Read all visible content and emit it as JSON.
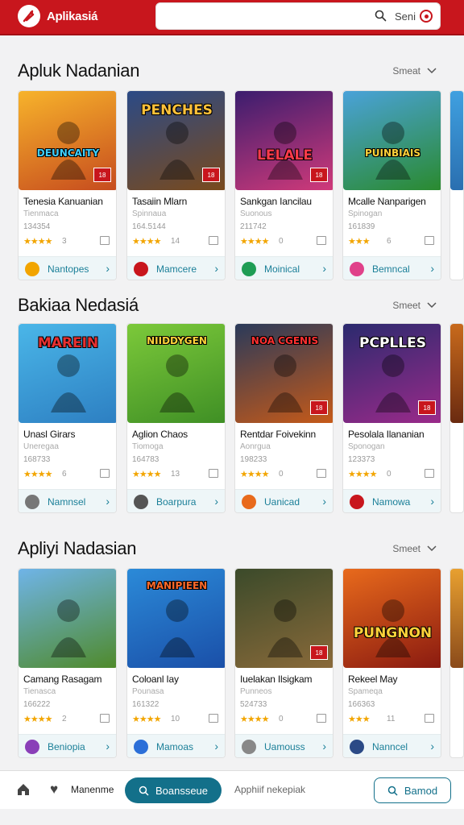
{
  "header": {
    "app_name": "Aplikasiá",
    "search_text": "Seni"
  },
  "sections": [
    {
      "title": "Apluk Nadanian",
      "more": "Smeat",
      "cards": [
        {
          "art_text": "DEUNCAITY",
          "art_colors": [
            "#f7b32b",
            "#c64b1e"
          ],
          "text_color": "#3fd0ff",
          "name": "Tenesia Kanuanian",
          "sub": "Tienmaca",
          "size": "134354",
          "stars": "★★★★",
          "rating_count": "3",
          "foot_label": "Nantopes",
          "foot_icon_color": "#f2a500"
        },
        {
          "art_text": "PENCHES",
          "art_colors": [
            "#2b4a86",
            "#7a4a1c"
          ],
          "text_color": "#ffc23a",
          "name": "Tasaiin Mlarn",
          "sub": "Spinnaua",
          "size": "164.5144",
          "stars": "★★★★",
          "rating_count": "14",
          "foot_label": "Mamcere",
          "foot_icon_color": "#c8161d"
        },
        {
          "art_text": "LELALE",
          "art_colors": [
            "#3b1d6e",
            "#d13a7a"
          ],
          "text_color": "#ff3b4a",
          "name": "Sankgan Iancilau",
          "sub": "Suonous",
          "size": "211742",
          "stars": "★★★★",
          "rating_count": "0",
          "foot_label": "Moinical",
          "foot_icon_color": "#1f9d55"
        },
        {
          "art_text": "PUINBIAIS",
          "art_colors": [
            "#4aa2d9",
            "#2a8a2e"
          ],
          "text_color": "#ffd23a",
          "name": "Mcalle Nanparigen",
          "sub": "Spinogan",
          "size": "161839",
          "stars": "★★★",
          "rating_count": "6",
          "foot_label": "Bemncal",
          "foot_icon_color": "#e0418a"
        }
      ]
    },
    {
      "title": "Bakiaa Nedasiá",
      "more": "Smeet",
      "cards": [
        {
          "art_text": "MAREIN",
          "art_colors": [
            "#4ab6e8",
            "#2d7fc2"
          ],
          "text_color": "#e83030",
          "name": "Unasl Girars",
          "sub": "Uneregaa",
          "size": "168733",
          "stars": "★★★★",
          "rating_count": "6",
          "foot_label": "Namnsel",
          "foot_icon_color": "#777"
        },
        {
          "art_text": "NIIDDYGEN",
          "art_colors": [
            "#7cc93a",
            "#3f8f25"
          ],
          "text_color": "#ffd23a",
          "name": "Aglion Chaos",
          "sub": "Tiomoga",
          "size": "164783",
          "stars": "★★★★",
          "rating_count": "13",
          "foot_label": "Boarpura",
          "foot_icon_color": "#555"
        },
        {
          "art_text": "NOA CGENIS",
          "art_colors": [
            "#2a3a5a",
            "#c75a18"
          ],
          "text_color": "#ff3030",
          "name": "Rentdar Foivekinn",
          "sub": "Aonrgua",
          "size": "198233",
          "stars": "★★★★",
          "rating_count": "0",
          "foot_label": "Uanicad",
          "foot_icon_color": "#e86a1c"
        },
        {
          "art_text": "PCPLLES",
          "art_colors": [
            "#2b2a6e",
            "#9b2a8a"
          ],
          "text_color": "#ffffff",
          "name": "Pesolala Ilananian",
          "sub": "Sponogan",
          "size": "123373",
          "stars": "★★★★",
          "rating_count": "0",
          "foot_label": "Namowa",
          "foot_icon_color": "#c8161d"
        }
      ]
    },
    {
      "title": "Apliyi Nadasian",
      "more": "Smeet",
      "cards": [
        {
          "art_text": "",
          "art_colors": [
            "#6fb4e8",
            "#4f8a2a"
          ],
          "text_color": "#ffffff",
          "name": "Camang Rasagam",
          "sub": "Tienasca",
          "size": "166222",
          "stars": "★★★★",
          "rating_count": "2",
          "foot_label": "Beniopia",
          "foot_icon_color": "#8a3fb8"
        },
        {
          "art_text": "MANIPIEEN",
          "art_colors": [
            "#2b8ad8",
            "#1a4fa8"
          ],
          "text_color": "#ff6a2a",
          "name": "Coloanl Iay",
          "sub": "Pounasa",
          "size": "161322",
          "stars": "★★★★",
          "rating_count": "10",
          "foot_label": "Mamoas",
          "foot_icon_color": "#2b6fd8"
        },
        {
          "art_text": "",
          "art_colors": [
            "#3b4a2a",
            "#8a6a3a"
          ],
          "text_color": "#ffffff",
          "name": "Iuelakan Ilsigkam",
          "sub": "Punneos",
          "size": "524733",
          "stars": "★★★★",
          "rating_count": "0",
          "foot_label": "Uamouss",
          "foot_icon_color": "#888"
        },
        {
          "art_text": "PUNGNON",
          "art_colors": [
            "#e86a1c",
            "#8a1a10"
          ],
          "text_color": "#ffd23a",
          "name": "Rekeel May",
          "sub": "Spameqa",
          "size": "166363",
          "stars": "★★★",
          "rating_count": "11",
          "foot_label": "Nanncel",
          "foot_icon_color": "#2b4a86"
        }
      ]
    }
  ],
  "bottom_nav": {
    "tab1": "Manenme",
    "active": "Boansseue",
    "tab3": "Apphiif nekepiak",
    "action": "Bamod"
  }
}
